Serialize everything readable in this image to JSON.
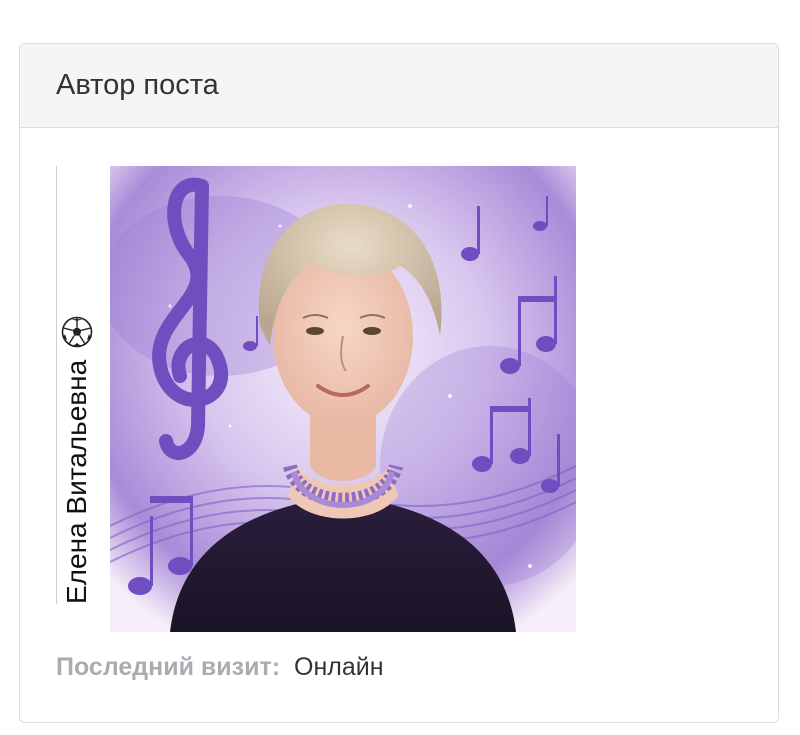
{
  "panel": {
    "title": "Автор поста"
  },
  "author": {
    "name": "Елена Витальевна",
    "badge_icon": "soccer-ball-icon",
    "avatar_description_icon": "portrait-with-music-notes"
  },
  "status": {
    "label": "Последний визит:",
    "value": "Онлайн"
  },
  "colors": {
    "header_bg": "#f5f5f5",
    "border": "#dcdcdc",
    "label_gray": "#a9adb2",
    "text_dark": "#333333",
    "avatar_purple": "#8f6fd0"
  }
}
